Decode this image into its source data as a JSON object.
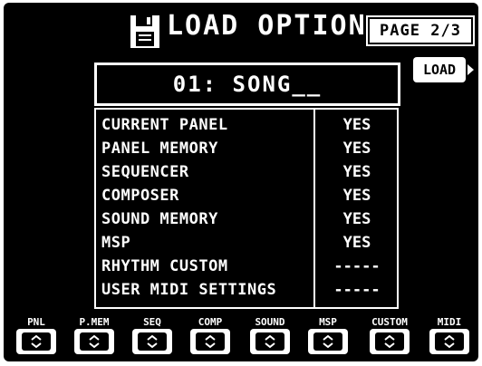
{
  "header": {
    "title": "LOAD OPTION",
    "page": "PAGE 2/3",
    "disk_icon": "floppy-disk-icon"
  },
  "song": {
    "name": "01: SONG__"
  },
  "load_button": {
    "label": "LOAD",
    "icon": "arrow-right-icon"
  },
  "options": [
    {
      "label": "CURRENT PANEL",
      "value": "YES"
    },
    {
      "label": "PANEL MEMORY",
      "value": "YES"
    },
    {
      "label": "SEQUENCER",
      "value": "YES"
    },
    {
      "label": "COMPOSER",
      "value": "YES"
    },
    {
      "label": "SOUND MEMORY",
      "value": "YES"
    },
    {
      "label": "MSP",
      "value": "YES"
    },
    {
      "label": "RHYTHM CUSTOM",
      "value": "-----"
    },
    {
      "label": "USER MIDI SETTINGS",
      "value": "-----"
    }
  ],
  "buttons": [
    {
      "label": "PNL"
    },
    {
      "label": "P.MEM"
    },
    {
      "label": "SEQ"
    },
    {
      "label": "COMP"
    },
    {
      "label": "SOUND"
    },
    {
      "label": "MSP"
    },
    {
      "label": "CUSTOM"
    },
    {
      "label": "MIDI"
    }
  ],
  "colors": {
    "background": "#000000",
    "foreground": "#ffffff"
  }
}
